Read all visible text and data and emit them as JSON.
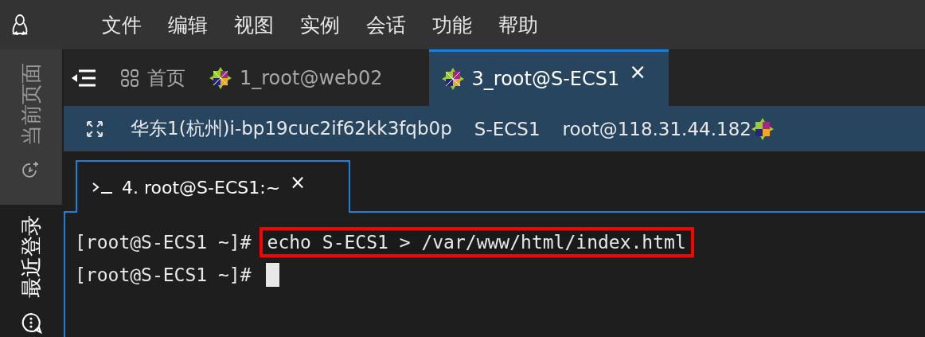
{
  "menu": [
    "文件",
    "编辑",
    "视图",
    "实例",
    "会话",
    "功能",
    "帮助"
  ],
  "sidebar": {
    "items": [
      {
        "label": "当前页面",
        "selected": true
      },
      {
        "label": "最近登录",
        "selected": false
      }
    ]
  },
  "tabs": [
    {
      "label": "首页",
      "kind": "home",
      "selected": false
    },
    {
      "label": "1_root@web02",
      "kind": "session",
      "selected": false
    },
    {
      "label": "3_root@S-ECS1",
      "kind": "session",
      "selected": true,
      "close": "×"
    }
  ],
  "info_bar": {
    "items": [
      "华东1(杭州)i-bp19cuc2if62kk3fqb0p",
      "S-ECS1",
      "root@118.31.44.182"
    ]
  },
  "terminal_tab": {
    "label": "4. root@S-ECS1:~",
    "close": "×"
  },
  "terminal": {
    "lines": [
      {
        "prompt": "[root@S-ECS1 ~]#",
        "command": "echo S-ECS1 > /var/www/html/index.html",
        "highlighted": true
      },
      {
        "prompt": "[root@S-ECS1 ~]#",
        "cursor": true
      }
    ]
  }
}
